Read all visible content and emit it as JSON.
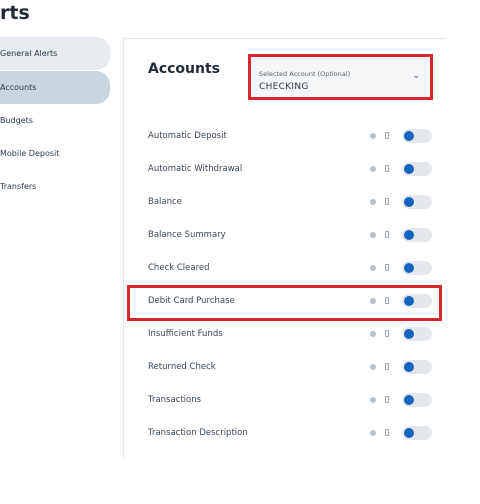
{
  "header": {
    "title": "rts"
  },
  "sidebar": {
    "items": [
      {
        "label": "General Alerts"
      },
      {
        "label": "Accounts"
      },
      {
        "label": "Budgets"
      },
      {
        "label": "Mobile Deposit"
      },
      {
        "label": "Transfers"
      }
    ]
  },
  "main": {
    "title": "Accounts",
    "account_select": {
      "label": "Selected Account (Optional)",
      "value": "CHECKING",
      "icon": "chevron-down-icon"
    },
    "alerts": [
      {
        "label": "Automatic Deposit",
        "enabled": true
      },
      {
        "label": "Automatic Withdrawal",
        "enabled": true
      },
      {
        "label": "Balance",
        "enabled": true
      },
      {
        "label": "Balance Summary",
        "enabled": true
      },
      {
        "label": "Check Cleared",
        "enabled": true
      },
      {
        "label": "Debit Card Purchase",
        "enabled": true
      },
      {
        "label": "Insufficient Funds",
        "enabled": true
      },
      {
        "label": "Returned Check",
        "enabled": true
      },
      {
        "label": "Transactions",
        "enabled": true
      },
      {
        "label": "Transaction Description",
        "enabled": true
      }
    ]
  },
  "colors": {
    "accent": "#1565c0",
    "highlight": "#d8262d",
    "active_nav": "#c9d5df"
  }
}
